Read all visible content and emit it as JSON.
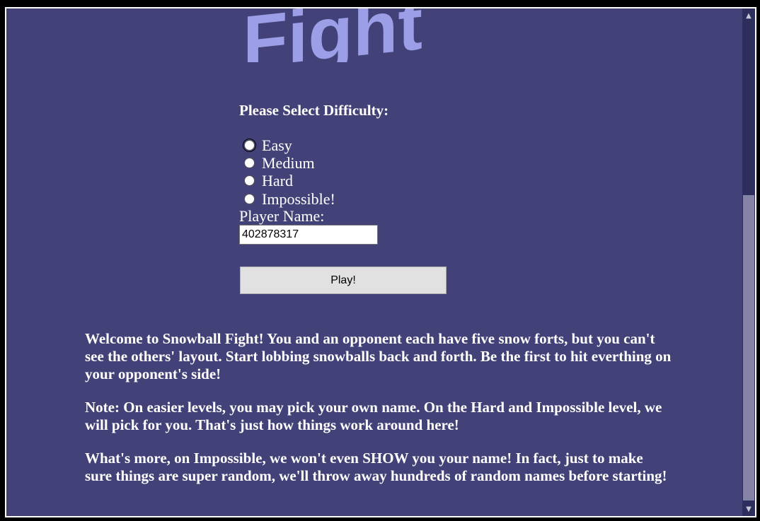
{
  "logo": {
    "text": "Fight"
  },
  "difficulty": {
    "title": "Please Select Difficulty:",
    "options": [
      {
        "label": "Easy",
        "checked": false,
        "focused": true
      },
      {
        "label": "Medium",
        "checked": false
      },
      {
        "label": "Hard",
        "checked": false
      },
      {
        "label": "Impossible!",
        "checked": false
      }
    ]
  },
  "player": {
    "label": "Player Name:",
    "value": "402878317"
  },
  "play_button": {
    "label": "Play!"
  },
  "info": {
    "paragraphs": [
      "Welcome to Snowball Fight! You and an opponent each have five snow forts, but you can't see the others' layout. Start lobbing snowballs back and forth. Be the first to hit everthing on your opponent's side!",
      "Note: On easier levels, you may pick your own name. On the Hard and Impossible level, we will pick for you. That's just how things work around here!",
      "What's more, on Impossible, we won't even SHOW you your name! In fact, just to make sure things are super random, we'll throw away hundreds of random names before starting!"
    ]
  },
  "scrollbar": {
    "up_icon": "chevron-up-icon",
    "down_icon": "chevron-down-icon"
  },
  "colors": {
    "background": "#434278",
    "logo": "#9c9ee8",
    "text": "#ffffff",
    "button": "#e1e1e1"
  }
}
